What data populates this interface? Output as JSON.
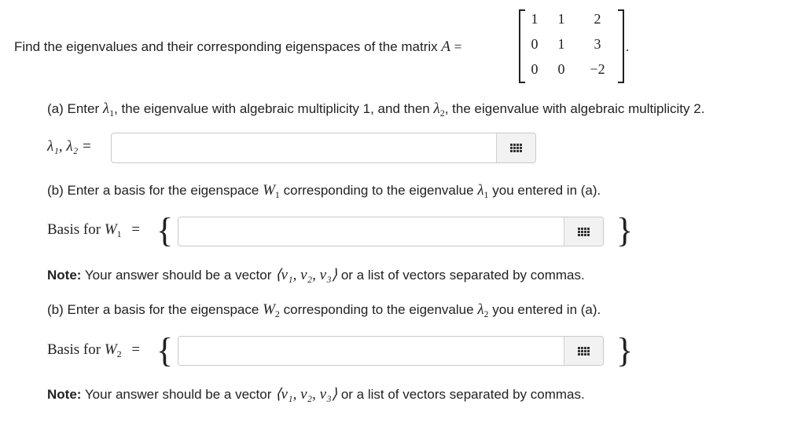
{
  "question": {
    "prefix": "Find the eigenvalues and their corresponding eigenspaces of the matrix",
    "matrix_var": "A",
    "equals": "=",
    "suffix": ".",
    "matrix": [
      [
        "1",
        "1",
        "2"
      ],
      [
        "0",
        "1",
        "3"
      ],
      [
        "0",
        "0",
        "−2"
      ]
    ]
  },
  "part_a": {
    "text_1": "(a) Enter",
    "lambda1": "λ",
    "sub1": "1",
    "text_2": ", the eigenvalue with algebraic multiplicity 1, and then",
    "lambda2": "λ",
    "sub2": "2",
    "text_3": ", the eigenvalue with algebraic multiplicity 2.",
    "input_label": "λ₁, λ₂ =",
    "input_value": ""
  },
  "part_b1": {
    "text_1": "(b) Enter a basis for the eigenspace",
    "w": "W",
    "wsub": "1",
    "text_2": "corresponding to the eigenvalue",
    "lambda": "λ",
    "lsub": "1",
    "text_3": "you entered in (a).",
    "basis_label": "Basis for",
    "basis_w": "W",
    "basis_sub": "1",
    "basis_eq": "=",
    "brace_open": "{",
    "brace_close": "}",
    "input_value": "",
    "note_label": "Note:",
    "note_text_1": "Your answer should be a vector",
    "note_vector": "⟨v₁, v₂, v₃⟩",
    "note_text_2": "or a list of vectors separated by commas."
  },
  "part_b2": {
    "text_1": "(b) Enter a basis for the eigenspace",
    "w": "W",
    "wsub": "2",
    "text_2": "corresponding to the eigenvalue",
    "lambda": "λ",
    "lsub": "2",
    "text_3": "you entered in (a).",
    "basis_label": "Basis for",
    "basis_w": "W",
    "basis_sub": "2",
    "basis_eq": "=",
    "brace_open": "{",
    "brace_close": "}",
    "input_value": "",
    "note_label": "Note:",
    "note_text_1": "Your answer should be a vector",
    "note_vector": "⟨v₁, v₂, v₃⟩",
    "note_text_2": "or a list of vectors separated by commas."
  },
  "icons": {
    "keyboard": "keypad-grid-icon"
  }
}
